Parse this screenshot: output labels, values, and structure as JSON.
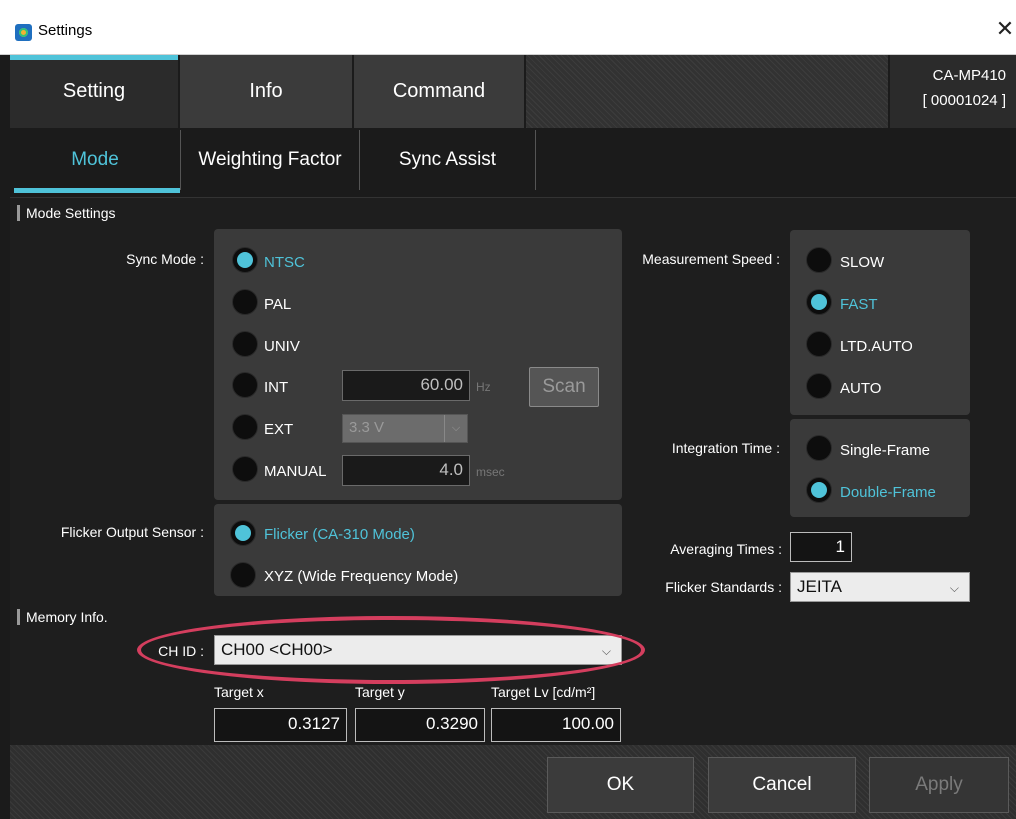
{
  "window": {
    "title": "Settings",
    "close_glyph": "✕"
  },
  "main_tabs": [
    {
      "label": "Setting",
      "active": true
    },
    {
      "label": "Info",
      "active": false
    },
    {
      "label": "Command",
      "active": false
    }
  ],
  "device": {
    "name": "CA-MP410",
    "serial": "[ 00001024 ]"
  },
  "sub_tabs": [
    {
      "label": "Mode",
      "active": true
    },
    {
      "label": "Weighting Factor",
      "active": false
    },
    {
      "label": "Sync Assist",
      "active": false
    }
  ],
  "mode_settings": {
    "title": "Mode Settings",
    "sync_mode": {
      "label": "Sync Mode :",
      "options": [
        "NTSC",
        "PAL",
        "UNIV",
        "INT",
        "EXT",
        "MANUAL"
      ],
      "selected": "NTSC",
      "int_value": "60.00",
      "int_unit": "Hz",
      "scan_label": "Scan",
      "ext_value": "3.3 V",
      "manual_value": "4.0",
      "manual_unit": "msec"
    },
    "flicker_output_sensor": {
      "label": "Flicker Output Sensor :",
      "options": [
        "Flicker (CA-310 Mode)",
        "XYZ (Wide Frequency Mode)"
      ],
      "selected": "Flicker (CA-310 Mode)"
    },
    "measurement_speed": {
      "label": "Measurement Speed :",
      "options": [
        "SLOW",
        "FAST",
        "LTD.AUTO",
        "AUTO"
      ],
      "selected": "FAST"
    },
    "integration_time": {
      "label": "Integration Time :",
      "options": [
        "Single-Frame",
        "Double-Frame"
      ],
      "selected": "Double-Frame"
    },
    "averaging_times": {
      "label": "Averaging Times :",
      "value": "1"
    },
    "flicker_standards": {
      "label": "Flicker Standards :",
      "value": "JEITA"
    }
  },
  "memory_info": {
    "title": "Memory Info.",
    "ch_id_label": "CH ID :",
    "ch_id_value": "CH00 <CH00>",
    "targets": [
      {
        "label": "Target x",
        "value": "0.3127"
      },
      {
        "label": "Target y",
        "value": "0.3290"
      },
      {
        "label": "Target Lv [cd/m²]",
        "value": "100.00"
      }
    ]
  },
  "buttons": {
    "ok": "OK",
    "cancel": "Cancel",
    "apply": "Apply"
  },
  "colors": {
    "accent": "#4fc3d9",
    "highlight_ring": "#d43e5e",
    "background": "#1b1b1b"
  },
  "icons": {
    "app": "app-icon",
    "close": "close-icon",
    "dropdown": "chevron-down-icon"
  }
}
